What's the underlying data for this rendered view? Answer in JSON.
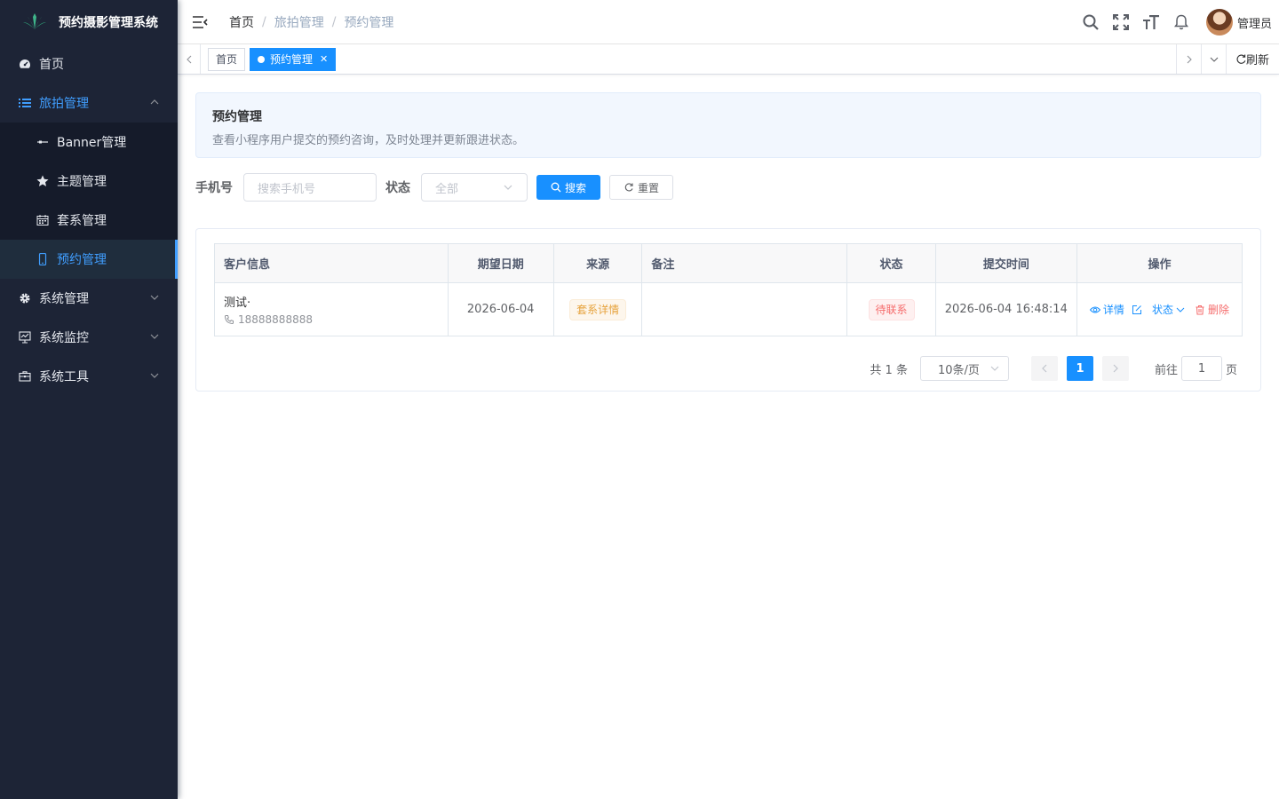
{
  "app": {
    "title": "预约摄影管理系统"
  },
  "sidebar": {
    "items": [
      {
        "label": "首页",
        "icon": "dashboard-icon"
      },
      {
        "label": "旅拍管理",
        "icon": "list-icon",
        "open": true,
        "children": [
          {
            "label": "Banner管理",
            "icon": "banner-icon"
          },
          {
            "label": "主题管理",
            "icon": "star-icon"
          },
          {
            "label": "套系管理",
            "icon": "calendar-icon"
          },
          {
            "label": "预约管理",
            "icon": "phone-icon",
            "active": true
          }
        ]
      },
      {
        "label": "系统管理",
        "icon": "gear-icon"
      },
      {
        "label": "系统监控",
        "icon": "monitor-icon"
      },
      {
        "label": "系统工具",
        "icon": "toolbox-icon"
      }
    ]
  },
  "navbar": {
    "breadcrumb": [
      "首页",
      "旅拍管理",
      "预约管理"
    ],
    "user_name": "管理员"
  },
  "tags_view": {
    "tags": [
      {
        "label": "首页"
      },
      {
        "label": "预约管理",
        "active": true
      }
    ],
    "refresh_label": "刷新"
  },
  "intro": {
    "title": "预约管理",
    "desc": "查看小程序用户提交的预约咨询，及时处理并更新跟进状态。"
  },
  "search": {
    "phone_label": "手机号",
    "phone_placeholder": "搜索手机号",
    "status_label": "状态",
    "status_value": "全部",
    "search_button": "搜索",
    "reset_button": "重置"
  },
  "table": {
    "headers": [
      "客户信息",
      "期望日期",
      "来源",
      "备注",
      "状态",
      "提交时间",
      "操作"
    ],
    "rows": [
      {
        "name": "测试·",
        "phone": "18888888888",
        "date": "2026-06-04",
        "source": "套系详情",
        "remark": "",
        "status": "待联系",
        "submitted": "2026-06-04 16:48:14",
        "actions": {
          "detail": "详情",
          "status": "状态",
          "delete": "删除"
        }
      }
    ]
  },
  "pagination": {
    "total": "共 1 条",
    "page_size": "10条/页",
    "current_page": "1",
    "goto_label": "前往",
    "goto_value": "1",
    "page_suffix": "页"
  },
  "colors": {
    "primary": "#1890ff",
    "sidebar": "#1d2436",
    "danger": "#f56c6c",
    "warning": "#e6a23c"
  }
}
